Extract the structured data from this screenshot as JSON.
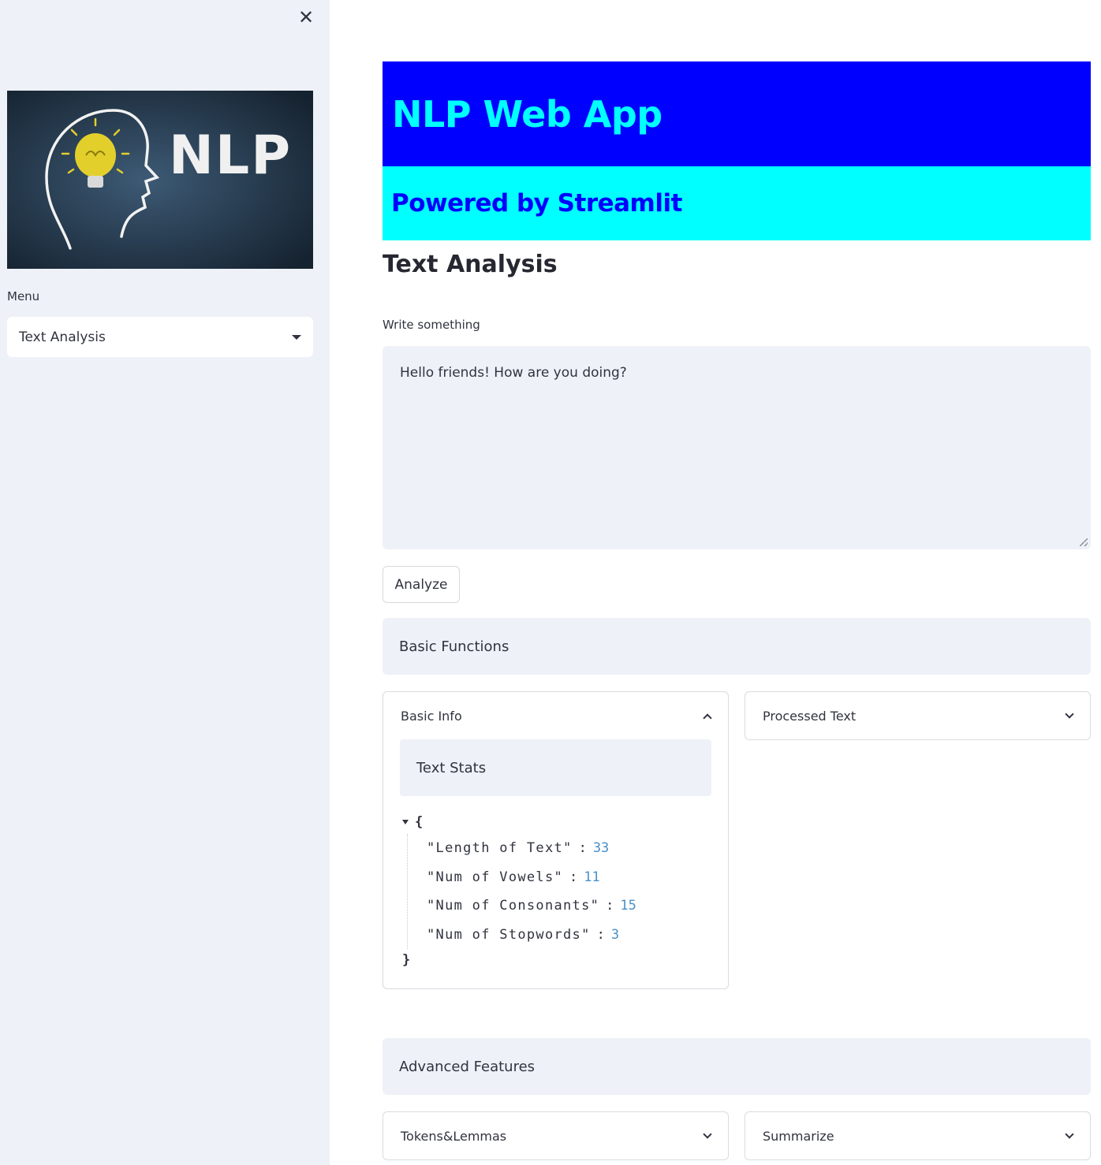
{
  "sidebar": {
    "menu_label": "Menu",
    "menu_selected": "Text Analysis",
    "logo_text": "NLP"
  },
  "header": {
    "title": "NLP Web App",
    "subtitle": "Powered by Streamlit"
  },
  "main": {
    "section_title": "Text Analysis",
    "input_label": "Write something",
    "input_value": "Hello friends! How are you doing?",
    "analyze_label": "Analyze",
    "basic_functions_label": "Basic Functions",
    "advanced_features_label": "Advanced Features"
  },
  "expanders": {
    "basic_info": "Basic Info",
    "processed_text": "Processed Text",
    "tokens_lemmas": "Tokens&Lemmas",
    "summarize": "Summarize"
  },
  "text_stats": {
    "title": "Text Stats",
    "rows": [
      {
        "key": "\"Length of Text\"",
        "value": "33"
      },
      {
        "key": "\"Num of Vowels\"",
        "value": "11"
      },
      {
        "key": "\"Num of Consonants\"",
        "value": "15"
      },
      {
        "key": "\"Num of Stopwords\"",
        "value": "3"
      }
    ]
  },
  "colors": {
    "title_bg": "#0000ff",
    "title_fg": "#00ffff",
    "subtitle_bg": "#00ffff",
    "subtitle_fg": "#0000ff"
  }
}
